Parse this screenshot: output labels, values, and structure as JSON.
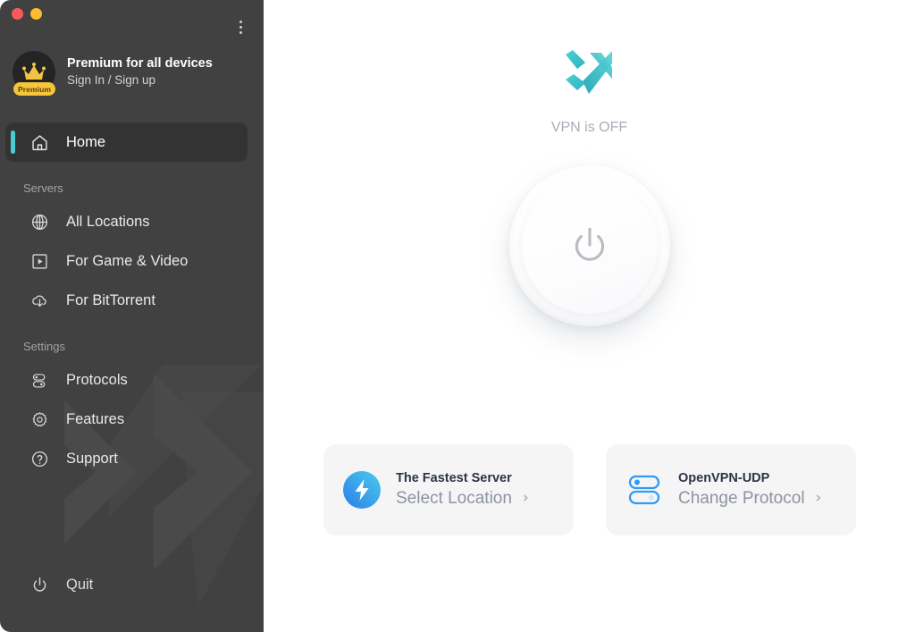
{
  "window": {
    "controls": [
      {
        "name": "close",
        "color": "#f9595a"
      },
      {
        "name": "minimize",
        "color": "#fbbd2e"
      }
    ]
  },
  "sidebar": {
    "background": "#414141",
    "accent_color": "#45cfd4",
    "account": {
      "title": "Premium for all devices",
      "subtitle": "Sign In / Sign up",
      "badge": "Premium",
      "avatar_icon": "crown-icon",
      "menu_icon": "more-vertical-icon"
    },
    "nav": [
      {
        "label": "Home",
        "icon": "home-icon",
        "active": true
      }
    ],
    "sections": [
      {
        "title": "Servers",
        "items": [
          {
            "label": "All Locations",
            "icon": "globe-icon"
          },
          {
            "label": "For Game & Video",
            "icon": "play-box-icon"
          },
          {
            "label": "For BitTorrent",
            "icon": "cloud-download-icon"
          }
        ]
      },
      {
        "title": "Settings",
        "items": [
          {
            "label": "Protocols",
            "icon": "toggles-icon"
          },
          {
            "label": "Features",
            "icon": "gear-icon"
          },
          {
            "label": "Support",
            "icon": "help-circle-icon"
          }
        ]
      }
    ],
    "quit": {
      "label": "Quit",
      "icon": "power-icon"
    }
  },
  "main": {
    "logo_icon": "x-vpn-logo",
    "logo_color": "#3fc0c8",
    "status_text": "VPN is OFF",
    "power_button": {
      "icon": "power-icon",
      "state": "off"
    },
    "cards": [
      {
        "icon": "lightning-bolt-icon",
        "title": "The Fastest Server",
        "subtitle": "Select Location",
        "chevron": "›"
      },
      {
        "icon": "protocol-toggles-icon",
        "title": "OpenVPN-UDP",
        "subtitle": "Change Protocol",
        "chevron": "›"
      }
    ]
  }
}
